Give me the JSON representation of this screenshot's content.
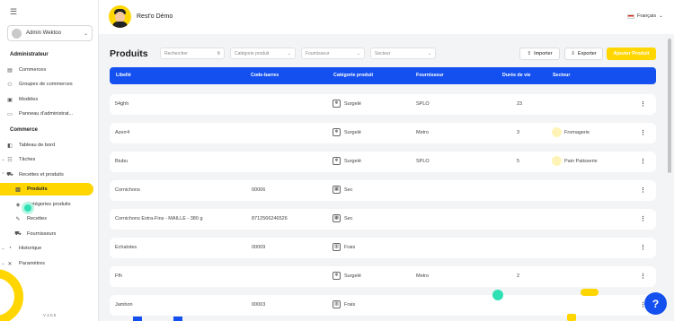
{
  "app": {
    "title": "Rest'o Démo",
    "language": "Français",
    "version": "V 2.0.5"
  },
  "sidebar": {
    "user": "Admin Wektoo",
    "sections": [
      {
        "title": "Administrateur",
        "items": [
          "Commerces",
          "Groupes de commerces",
          "Modèles",
          "Panneau d'administrat..."
        ]
      },
      {
        "title": "Commerce",
        "items": [
          "Tableau de bord",
          "Tâches",
          "Recettes et produits",
          "Produits",
          "Catégories produits",
          "Recettes",
          "Fournisseurs",
          "Historique",
          "Paramètres"
        ]
      }
    ]
  },
  "page": {
    "title": "Produits"
  },
  "toolbar": {
    "search_placeholder": "Rechercher",
    "category_placeholder": "Catégorie produit",
    "supplier_placeholder": "Fournisseur",
    "sector_placeholder": "Secteur",
    "import_label": "Importer",
    "export_label": "Exporter",
    "add_label": "Ajouter Produit"
  },
  "table": {
    "headers": [
      "Libellé",
      "Code-barres",
      "Catégorie produit",
      "Fournisseur",
      "Durée de vie",
      "Secteur"
    ],
    "rows": [
      {
        "name": "54ghh",
        "barcode": "",
        "category": "Surgelé",
        "cat_icon": "❄",
        "supplier": "SPLO",
        "life": "23",
        "sector": ""
      },
      {
        "name": "Azerr4",
        "barcode": "",
        "category": "Surgelé",
        "cat_icon": "❄",
        "supplier": "Metro",
        "life": "3",
        "sector": "Fromagerie"
      },
      {
        "name": "Biubu",
        "barcode": "",
        "category": "Surgelé",
        "cat_icon": "❄",
        "supplier": "SPLO",
        "life": "5",
        "sector": "Pain Patisserie"
      },
      {
        "name": "Cornichons",
        "barcode": "00006",
        "category": "Sec",
        "cat_icon": "▦",
        "supplier": "",
        "life": "",
        "sector": ""
      },
      {
        "name": "Cornichons Extra-Fins - MAILLE - 380 g",
        "barcode": "8712566246526",
        "category": "Sec",
        "cat_icon": "▦",
        "supplier": "",
        "life": "",
        "sector": ""
      },
      {
        "name": "Echalotes",
        "barcode": "00009",
        "category": "Frais",
        "cat_icon": "▥",
        "supplier": "",
        "life": "",
        "sector": ""
      },
      {
        "name": "Ffh",
        "barcode": "",
        "category": "Surgelé",
        "cat_icon": "❄",
        "supplier": "Metro",
        "life": "2",
        "sector": ""
      },
      {
        "name": "Jambon",
        "barcode": "00003",
        "category": "Frais",
        "cat_icon": "▥",
        "supplier": "",
        "life": "",
        "sector": ""
      }
    ]
  },
  "colors": {
    "accent": "#ffd600",
    "primary": "#1450f0"
  }
}
